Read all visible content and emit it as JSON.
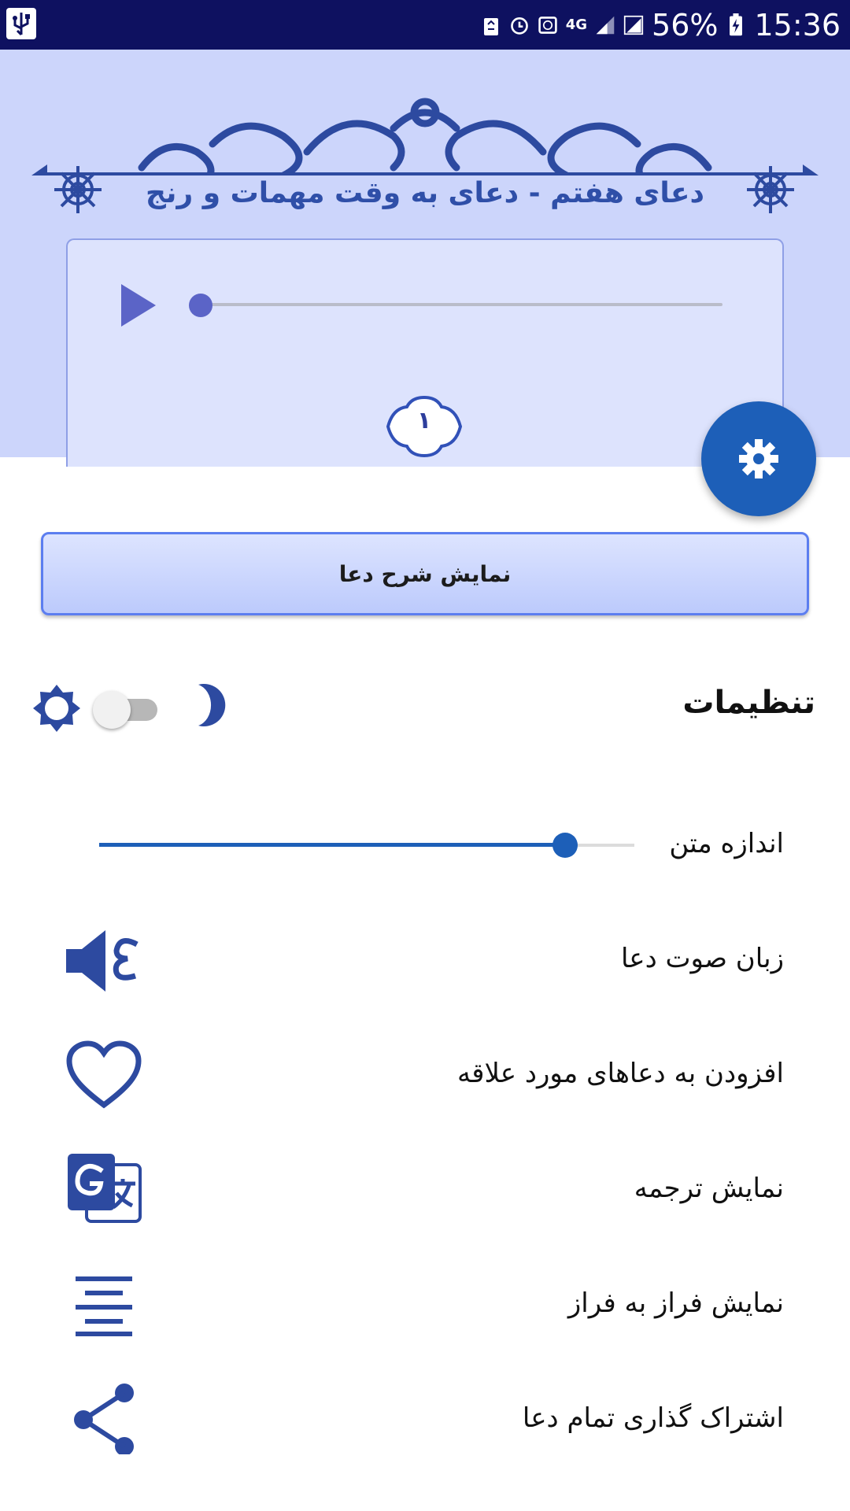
{
  "status_bar": {
    "battery": "56%",
    "time": "15:36",
    "network": "4G",
    "icons": [
      "usb-icon",
      "recycle-icon",
      "alarm-icon",
      "vpn-icon",
      "signal-icon",
      "signal-icon",
      "battery-charging-icon"
    ]
  },
  "header": {
    "title": "دعای هفتم - دعای به وقت مهمات و رنج",
    "page_number": "۱",
    "playback_progress": 0
  },
  "explain_button": {
    "label": "نمایش شرح دعا"
  },
  "settings": {
    "title": "تنظیمات",
    "night_mode": false,
    "text_size_label": "اندازه متن",
    "text_size_value": 0.87,
    "items": [
      {
        "label": "زبان صوت دعا",
        "icon": "audio-language-icon"
      },
      {
        "label": "افزودن به دعاهای مورد علاقه",
        "icon": "heart-icon"
      },
      {
        "label": "نمایش ترجمه",
        "icon": "translate-icon"
      },
      {
        "label": "نمایش فراز به فراز",
        "icon": "align-center-icon"
      },
      {
        "label": "اشتراک گذاری تمام دعا",
        "icon": "share-icon"
      }
    ]
  },
  "colors": {
    "header_bg": "#ccd5fb",
    "accent": "#1d5fb8",
    "title": "#2f4fa8",
    "status_bar": "#0e1160"
  }
}
